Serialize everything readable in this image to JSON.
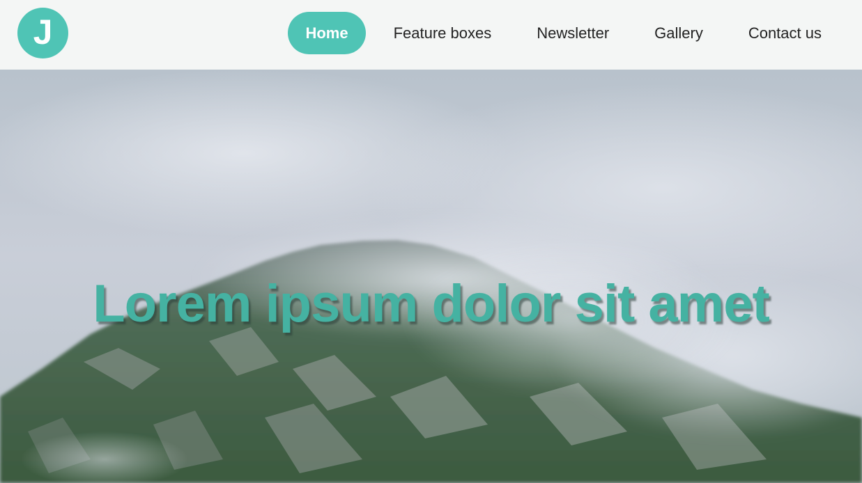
{
  "brand": {
    "logo_letter": "J",
    "accent_color": "#4fc4b5"
  },
  "nav": {
    "items": [
      {
        "label": "Home",
        "active": true
      },
      {
        "label": "Feature boxes",
        "active": false
      },
      {
        "label": "Newsletter",
        "active": false
      },
      {
        "label": "Gallery",
        "active": false
      },
      {
        "label": "Contact us",
        "active": false
      }
    ]
  },
  "hero": {
    "title": "Lorem ipsum dolor sit amet",
    "title_color": "#45b2a2",
    "background": "misty-mountain-photo"
  }
}
